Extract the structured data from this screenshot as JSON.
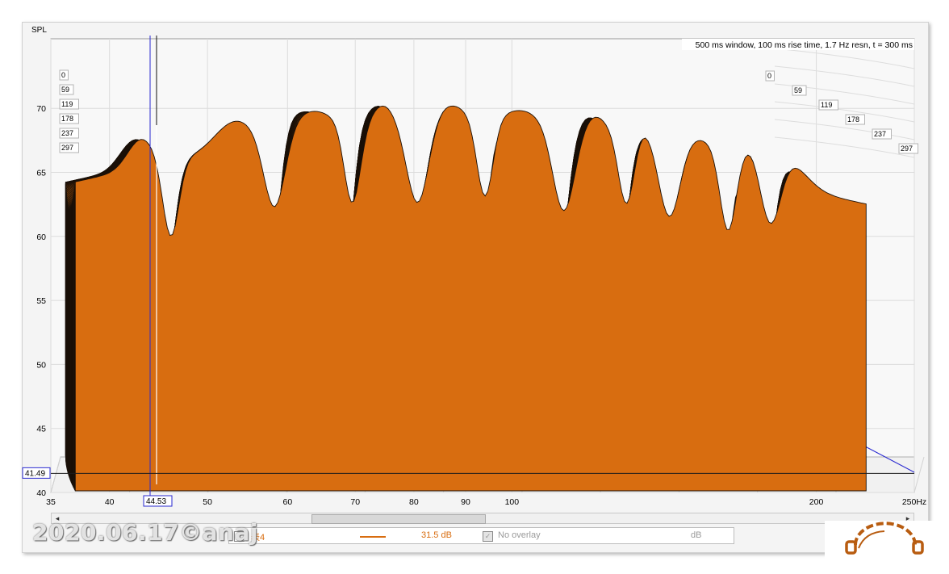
{
  "chart_data": {
    "type": "waterfall",
    "title": "500 ms window, 100 ms rise time, 1.7 Hz resn, t = 300 ms",
    "ylabel": "SPL",
    "xunit": "Hz",
    "xlim": [
      35,
      250
    ],
    "ylim": [
      40,
      72
    ],
    "x_ticks": [
      "35",
      "40",
      "50",
      "60",
      "70",
      "80",
      "90",
      "100",
      "200",
      "250Hz"
    ],
    "y_ticks": [
      "40",
      "45",
      "50",
      "55",
      "60",
      "65",
      "70"
    ],
    "time_ticks_ms": [
      "0",
      "59",
      "119",
      "178",
      "237",
      "297"
    ],
    "cursor": {
      "frequency_label": "44.53",
      "spl_label": "41.49"
    },
    "surface_color": "#d86d10",
    "slice_count": 60,
    "peak_frequencies_hz": [
      42,
      52,
      62,
      73,
      85,
      100,
      118,
      130,
      150,
      170,
      182
    ],
    "notch_frequencies_hz": [
      45,
      57,
      68,
      79,
      92,
      110,
      127,
      140,
      160,
      176
    ]
  },
  "legend": {
    "measurement_name": "表4",
    "measurement_value": "31.5 dB",
    "overlay_label": "No overlay",
    "overlay_unit": "dB",
    "line_color": "#d86d10"
  },
  "scroll": {
    "left_arrow": "◂",
    "right_arrow": "▸"
  },
  "watermark": "2020.06.17©anaj",
  "logo": {
    "name": "headphone-logo",
    "color": "#b85c10"
  }
}
